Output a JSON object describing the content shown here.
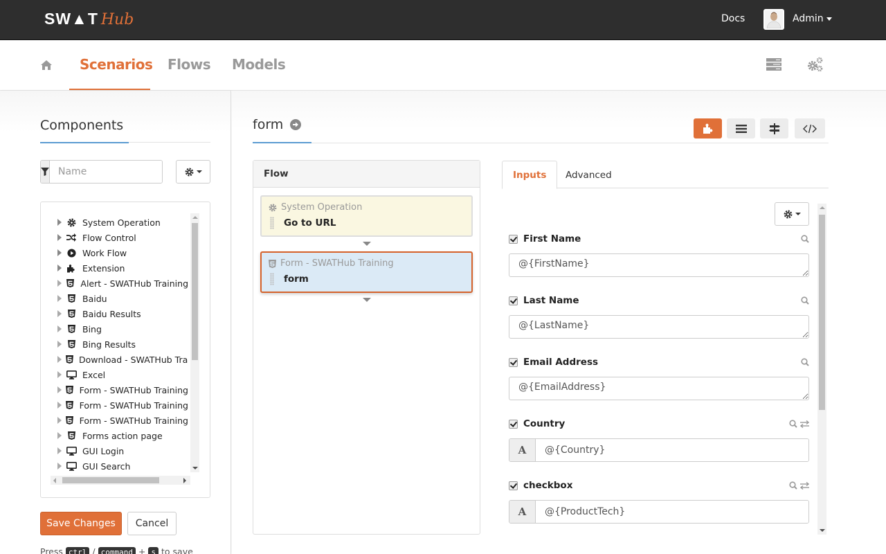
{
  "app": {
    "logo_main": "SW▲T",
    "logo_accent": "Hub"
  },
  "topbar": {
    "docs_label": "Docs",
    "user_label": "Admin"
  },
  "nav": {
    "home_icon": "home-icon",
    "tabs": [
      {
        "label": "Scenarios",
        "active": true
      },
      {
        "label": "Flows",
        "active": false
      },
      {
        "label": "Models",
        "active": false
      }
    ],
    "right_icons": [
      "server-icon",
      "gears-icon"
    ]
  },
  "components": {
    "title": "Components",
    "filter_placeholder": "Name",
    "filter_value": "",
    "tree": [
      {
        "label": "System Operation",
        "icon": "gear-icon"
      },
      {
        "label": "Flow Control",
        "icon": "random-icon"
      },
      {
        "label": "Work Flow",
        "icon": "play-circle-icon"
      },
      {
        "label": "Extension",
        "icon": "puzzle-icon"
      },
      {
        "label": "Alert - SWATHub Training",
        "icon": "html5-icon"
      },
      {
        "label": "Baidu",
        "icon": "html5-icon"
      },
      {
        "label": "Baidu Results",
        "icon": "html5-icon"
      },
      {
        "label": "Bing",
        "icon": "html5-icon"
      },
      {
        "label": "Bing Results",
        "icon": "html5-icon"
      },
      {
        "label": "Download - SWATHub Training",
        "icon": "html5-icon"
      },
      {
        "label": "Excel",
        "icon": "desktop-icon"
      },
      {
        "label": "Form - SWATHub Training",
        "icon": "html5-icon"
      },
      {
        "label": "Form - SWATHub Training",
        "icon": "html5-icon"
      },
      {
        "label": "Form - SWATHub Training",
        "icon": "html5-icon"
      },
      {
        "label": "Forms action page",
        "icon": "html5-icon"
      },
      {
        "label": "GUI Login",
        "icon": "desktop-icon"
      },
      {
        "label": "GUI Search",
        "icon": "desktop-icon"
      }
    ],
    "save_label": "Save Changes",
    "cancel_label": "Cancel",
    "hint": {
      "press": "Press",
      "key1": "ctrl",
      "sep": "/",
      "key2": "command",
      "plus": "+",
      "key3": "s",
      "suffix": "to save"
    }
  },
  "main": {
    "title": "form",
    "view_buttons": [
      {
        "name": "component-view",
        "icon": "puzzle-icon",
        "active": true
      },
      {
        "name": "list-view",
        "icon": "list-icon",
        "active": false
      },
      {
        "name": "signpost-view",
        "icon": "signpost-icon",
        "active": false
      },
      {
        "name": "code-view",
        "icon": "code-icon",
        "active": false
      }
    ],
    "flow": {
      "header": "Flow",
      "nodes": [
        {
          "type": "System Operation",
          "name": "Go to URL",
          "icon": "gear-icon",
          "selected": false
        },
        {
          "type": "Form - SWATHub Training",
          "name": "form",
          "icon": "html5-icon",
          "selected": true
        }
      ]
    },
    "tabs": [
      {
        "label": "Inputs",
        "active": true
      },
      {
        "label": "Advanced",
        "active": false
      }
    ],
    "inputs": [
      {
        "label": "First Name",
        "checked": true,
        "kind": "textarea",
        "value": "@{FirstName}",
        "tools": [
          "search-icon"
        ]
      },
      {
        "label": "Last Name",
        "checked": true,
        "kind": "textarea",
        "value": "@{LastName}",
        "tools": [
          "search-icon"
        ]
      },
      {
        "label": "Email Address",
        "checked": true,
        "kind": "textarea",
        "value": "@{EmailAddress}",
        "tools": [
          "search-icon"
        ]
      },
      {
        "label": "Country",
        "checked": true,
        "kind": "text",
        "addon": "A",
        "value": "@{Country}",
        "tools": [
          "search-icon",
          "exchange-icon"
        ]
      },
      {
        "label": "checkbox",
        "checked": true,
        "kind": "text",
        "addon": "A",
        "value": "@{ProductTech}",
        "tools": [
          "search-icon",
          "exchange-icon"
        ]
      }
    ]
  },
  "colors": {
    "accent": "#e07038",
    "topbar": "#2e2e2e",
    "link_underline": "#5b9bd1",
    "selected_node_bg": "#dbeaf6",
    "system_node_bg": "#faf7e1"
  }
}
